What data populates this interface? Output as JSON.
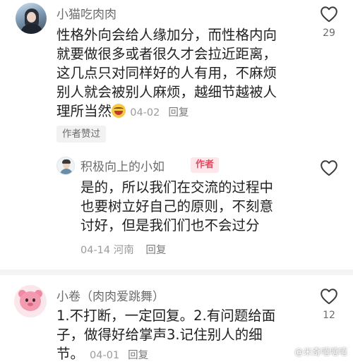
{
  "comments": [
    {
      "username": "小猫吃肉肉",
      "lines": [
        "性格外向会给人缘加分，而性格内向",
        "就要做很多或者很久才会拉近距离，",
        "这几点只对同样好的人有用，不麻烦",
        "别人就会被别人麻烦，越细节越被人",
        "理所当然"
      ],
      "date": "04-02",
      "reply": "回复",
      "likes": "29",
      "liked_badge": "作者赞过"
    },
    {
      "username": "积极向上的小如",
      "author_tag": "作者",
      "lines": [
        "是的，所以我们在交流的过程中",
        "也要树立好自己的原则，不刻意",
        "讨好，但是我们们也不会过分"
      ],
      "date": "04-14",
      "location": "河南",
      "reply": "回复"
    },
    {
      "username": "小卷（肉肉爱跳舞）",
      "lines": [
        "1.不打断，一定回复。2.有问题给面",
        "子，做得好给掌声3.记住别人的细",
        "节。"
      ],
      "date": "04-01",
      "reply": "回复",
      "likes": "12"
    }
  ],
  "watermark": "@米奇嘻嘻嘻",
  "icons": {
    "like": "heart-outline-icon",
    "emoji": "crying-laughing-emoji-icon"
  },
  "colors": {
    "author_tag_text": "#e2495f",
    "author_tag_bg": "#fde7ea",
    "meta": "#9a9a9a"
  }
}
